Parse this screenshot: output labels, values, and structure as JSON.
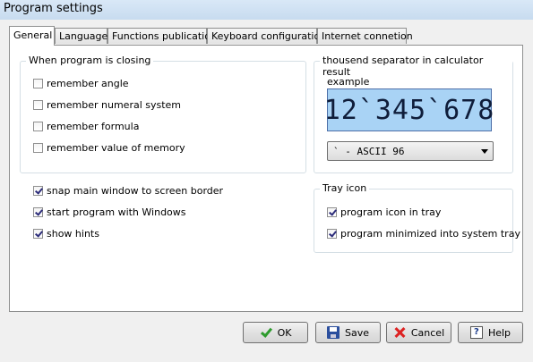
{
  "window": {
    "title": "Program settings"
  },
  "tabs": [
    {
      "label": "General",
      "active": true
    },
    {
      "label": "Language"
    },
    {
      "label": "Functions publication"
    },
    {
      "label": "Keyboard configuration"
    },
    {
      "label": "Internet connetion"
    }
  ],
  "closing_group": {
    "title": "When program is closing",
    "items": [
      {
        "label": "remember angle",
        "checked": false
      },
      {
        "label": "remember numeral system",
        "checked": false
      },
      {
        "label": "remember formula",
        "checked": false
      },
      {
        "label": "remember value of memory",
        "checked": false
      }
    ]
  },
  "general_options": [
    {
      "label": "snap main window to screen border",
      "checked": true
    },
    {
      "label": "start program with Windows",
      "checked": true
    },
    {
      "label": "show hints",
      "checked": true
    }
  ],
  "separator_group": {
    "title": "thousend separator in calculator result",
    "example_label": "example",
    "example_value": "12`345`678",
    "selected_option": "` - ASCII 96"
  },
  "tray_group": {
    "title": "Tray icon",
    "items": [
      {
        "label": "program icon in tray",
        "checked": true
      },
      {
        "label": "program minimized into system tray",
        "checked": true
      }
    ]
  },
  "buttons": {
    "ok": "OK",
    "save": "Save",
    "cancel": "Cancel",
    "help": "Help"
  },
  "icons": {
    "ok": "checkmark-icon",
    "save": "floppy-disk-icon",
    "cancel": "red-x-icon",
    "help": "question-mark-icon"
  }
}
